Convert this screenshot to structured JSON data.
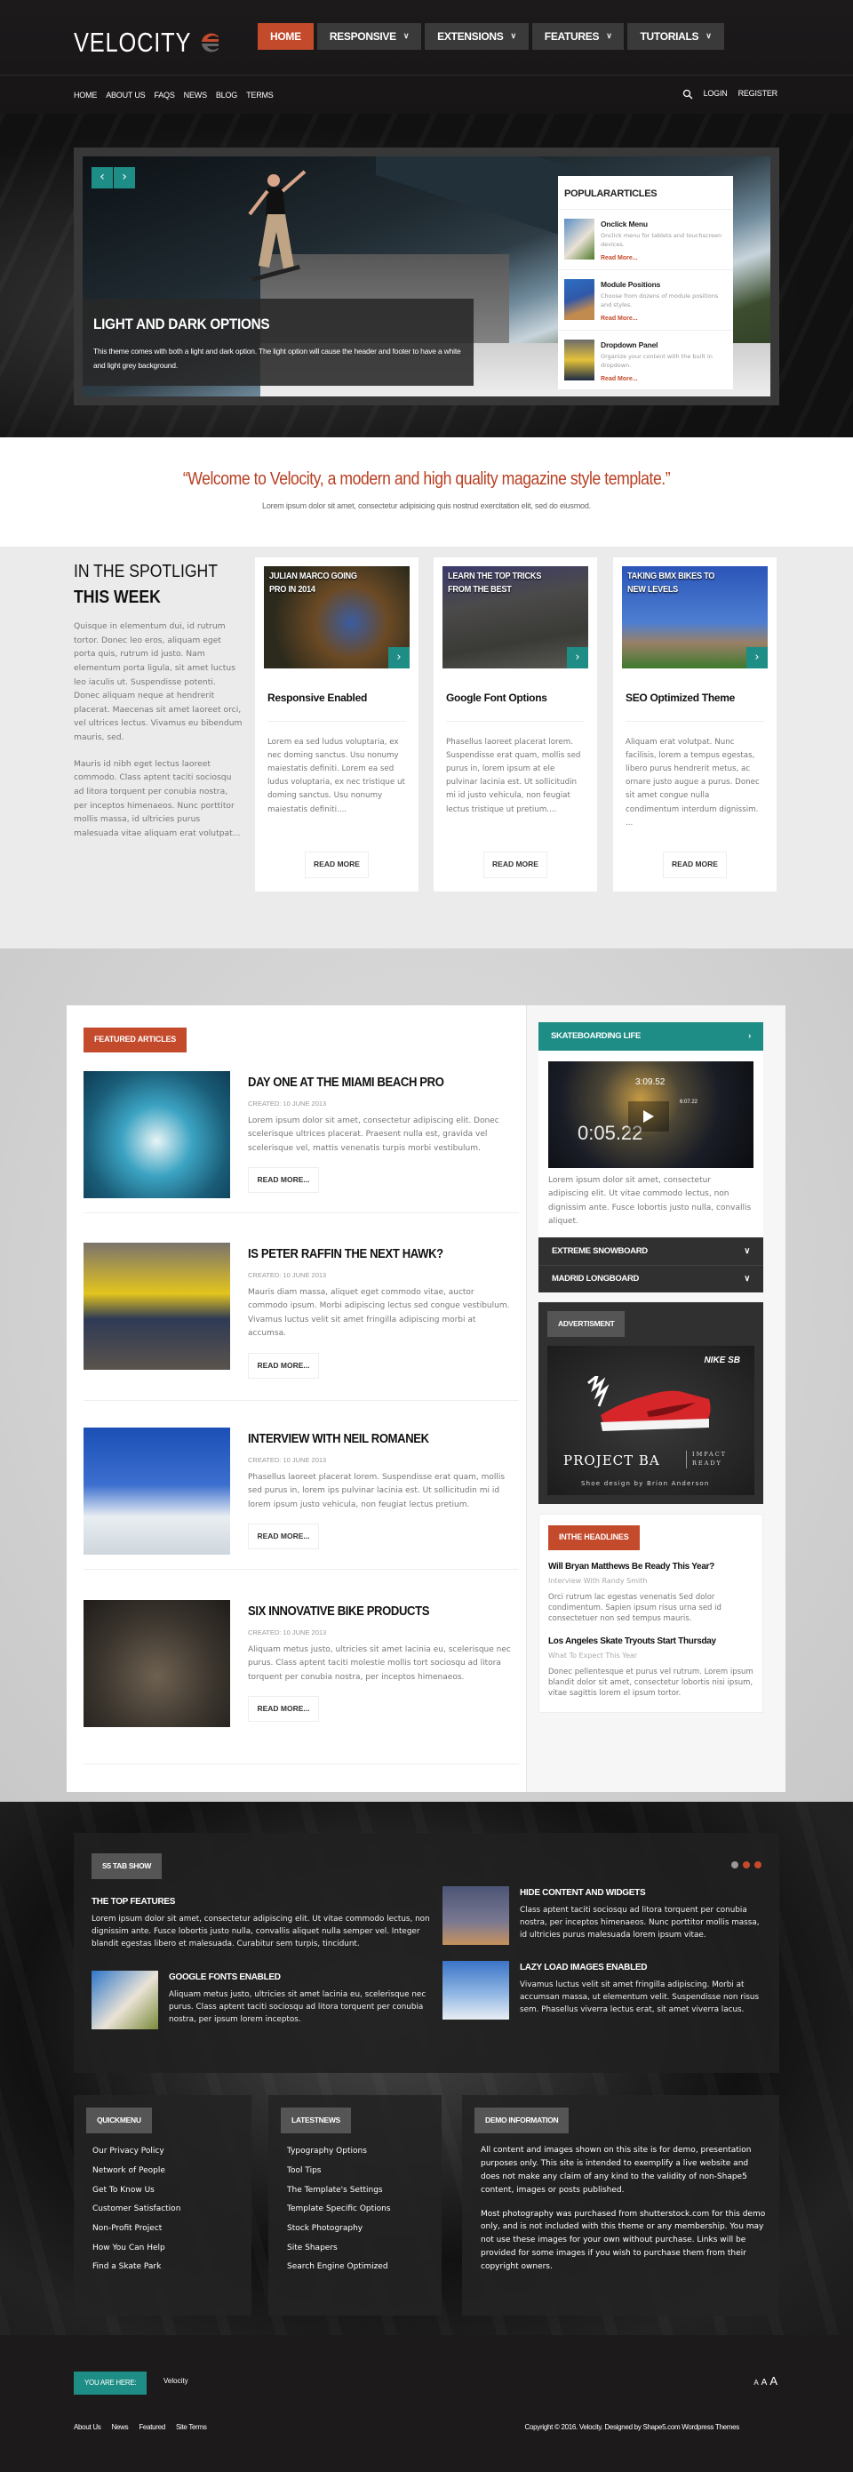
{
  "colors": {
    "accent_red": "#c44a2c",
    "accent_teal": "#1e8d85",
    "dark": "#1c1a1b"
  },
  "header": {
    "logo_text": "VELOCITY",
    "main_nav": [
      {
        "label": "HOME",
        "active": true,
        "dropdown": false
      },
      {
        "label": "RESPONSIVE",
        "active": false,
        "dropdown": true
      },
      {
        "label": "EXTENSIONS",
        "active": false,
        "dropdown": true
      },
      {
        "label": "FEATURES",
        "active": false,
        "dropdown": true
      },
      {
        "label": "TUTORIALS",
        "active": false,
        "dropdown": true
      }
    ],
    "sub_nav": [
      "HOME",
      "ABOUT US",
      "FAQS",
      "NEWS",
      "BLOG",
      "TERMS"
    ],
    "user_links": {
      "search_icon": "search-icon",
      "login": "LOGIN",
      "register": "REGISTER"
    }
  },
  "hero": {
    "prev_icon": "chevron-left-icon",
    "next_icon": "chevron-right-icon",
    "slide_title": "LIGHT AND DARK OPTIONS",
    "slide_text": "This theme comes with both a light and dark option. The light option will cause the header and footer to have a white and light grey background.",
    "popular": {
      "title": "POPULARARTICLES",
      "items": [
        {
          "title": "Onclick Menu",
          "text": "Onclick menu for tablets and touchscreen devices.",
          "link": "Read More..."
        },
        {
          "title": "Module Positions",
          "text": "Choose from dozens of module positions and styles.",
          "link": "Read More..."
        },
        {
          "title": "Dropdown Panel",
          "text": "Organize your content with the built in dropdown.",
          "link": "Read More..."
        }
      ]
    }
  },
  "welcome": {
    "quote": "“Welcome to Velocity, a modern and high quality magazine style template.”",
    "subtext": "Lorem ipsum dolor sit amet, consectetur adipisicing quis nostrud exercitation elit, sed do eiusmod."
  },
  "spotlight": {
    "title_light": "IN THE SPOTLIGHT",
    "title_bold": "THIS WEEK",
    "para1": "Quisque in elementum dui, id rutrum tortor. Donec leo eros, aliquam eget porta quis, rutrum id justo. Nam elementum porta ligula, sit amet luctus leo iaculis ut. Suspendisse potenti. Donec aliquam neque at hendrerit placerat. Maecenas sit amet laoreet orci, vel ultrices lectus. Vivamus eu bibendum mauris, sed.",
    "para2": "Mauris id nibh eget lectus laoreet commodo. Class aptent taciti sociosqu ad litora torquent per conubia nostra, per inceptos himenaeos. Nunc porttitor mollis massa, id ultricies purus malesuada vitae aliquam erat volutpat...",
    "cards": [
      {
        "image_caption": "JULIAN MARCO GOING PRO IN 2014",
        "title": "Responsive Enabled",
        "text": "Lorem ea sed ludus voluptaria, ex nec doming sanctus. Usu nonumy maiestatis definiti. Lorem ea sed ludus voluptaria, ex nec tristique ut doming sanctus. Usu nonumy maiestatis definiti....",
        "button": "READ MORE"
      },
      {
        "image_caption": "LEARN THE TOP TRICKS FROM THE BEST",
        "title": "Google Font Options",
        "text": "Phasellus laoreet placerat lorem. Suspendisse erat quam, mollis sed purus in, lorem ipsum at ele pulvinar lacinia est. Ut sollicitudin mi id justo vehicula, non feugiat lectus tristique ut pretium....",
        "button": "READ MORE"
      },
      {
        "image_caption": "TAKING BMX BIKES TO NEW LEVELS",
        "title": "SEO Optimized Theme",
        "text": "Aliquam erat volutpat. Nunc facilisis, lorem a tempus egestas, libero purus hendrerit metus, ac ornare justo augue a purus. Donec sit amet congue nulla condimentum interdum dignissim. ...",
        "button": "READ MORE"
      }
    ]
  },
  "featured": {
    "label": "FEATURED ARTICLES",
    "articles": [
      {
        "title": "DAY ONE AT THE MIAMI BEACH PRO",
        "date": "CREATED: 10 JUNE 2013",
        "text": "Lorem ipsum dolor sit amet, consectetur adipiscing elit. Donec scelerisque ultrices placerat. Praesent nulla est, gravida vel scelerisque vel, mattis venenatis turpis morbi vestibulum.",
        "button": "READ MORE..."
      },
      {
        "title": "IS PETER RAFFIN THE NEXT HAWK?",
        "date": "CREATED: 10 JUNE 2013",
        "text": "Mauris diam massa, aliquet eget commodo vitae, auctor commodo ipsum. Morbi adipiscing lectus sed congue vestibulum. Vivamus luctus velit sit amet fringilla adipiscing morbi at accumsa.",
        "button": "READ MORE..."
      },
      {
        "title": "INTERVIEW WITH NEIL ROMANEK",
        "date": "CREATED: 10 JUNE 2013",
        "text": "Phasellus laoreet placerat lorem. Suspendisse erat quam, mollis sed purus in, lorem ips pulvinar lacinia est. Ut sollicitudin mi id lorem ipsum justo vehicula, non feugiat lectus pretium.",
        "button": "READ MORE..."
      },
      {
        "title": "SIX INNOVATIVE BIKE PRODUCTS",
        "date": "CREATED: 10 JUNE 2013",
        "text": "Aliquam metus justo, ultricies sit amet lacinia eu, scelerisque nec purus. Class aptent taciti molestie mollis tort sociosqu ad litora torquent per conubia nostra, per inceptos himenaeos.",
        "button": "READ MORE..."
      }
    ]
  },
  "sidebar": {
    "skate": {
      "title": "SKATEBOARDING LIFE",
      "video_time_main": "0:05.22",
      "video_time_top": "3:09.52",
      "video_time_small": "6:07.22",
      "text": "Lorem ipsum dolor sit amet, consectetur adipiscing elit. Ut vitae commodo lectus, non dignissim ante. Fusce lobortis justo nulla, convallis aliquet."
    },
    "accordions": [
      "EXTREME SNOWBOARD",
      "MADRID LONGBOARD"
    ],
    "ad": {
      "label": "ADVERTISMENT",
      "brand": "NIKE SB",
      "product": "PROJECT BA",
      "tagline1": "IMPACT",
      "tagline2": "READY",
      "credit": "Shoe design by Brion Anderson"
    },
    "headlines": {
      "label": "INTHE HEADLINES",
      "items": [
        {
          "title": "Will Bryan Matthews Be Ready This Year?",
          "subtitle": "Interview With Randy Smith",
          "text": "Orci rutrum lac egestas venenatis Sed dolor condimentum. Sapien ipsum risus urna sed id consectetuer non sed tempus mauris."
        },
        {
          "title": "Los Angeles Skate Tryouts Start Thursday",
          "subtitle": "What To Expect This Year",
          "text": "Donec pellentesque et purus vel rutrum. Lorem ipsum blandit dolor sit amet, consectetur lobortis nisi ipsum, vitae sagittis lorem el ipsum tortor."
        }
      ]
    }
  },
  "tabshow": {
    "label": "S5 TAB SHOW",
    "active_dot": 0,
    "dot_count": 3,
    "top_feature": {
      "title": "THE TOP FEATURES",
      "text": "Lorem ipsum dolor sit amet, consectetur adipiscing elit. Ut vitae commodo lectus, non dignissim ante. Fusce lobortis justo nulla, convallis aliquet nulla semper vel. Integer blandit egestas libero et malesuada. Curabitur sem turpis, tincidunt."
    },
    "items": [
      {
        "title": "GOOGLE FONTS ENABLED",
        "text": "Aliquam metus justo, ultricies sit amet lacinia eu, scelerisque nec purus. Class aptent taciti sociosqu ad litora torquent per conubia nostra, per ipsum lorem inceptos."
      },
      {
        "title": "HIDE CONTENT AND WIDGETS",
        "text": "Class aptent taciti sociosqu ad litora torquent per conubia nostra, per inceptos himenaeos. Nunc porttitor mollis massa, id ultricies purus malesuada lorem ipsum vitae."
      },
      {
        "title": "LAZY LOAD IMAGES ENABLED",
        "text": "Vivamus luctus velit sit amet fringilla adipiscing. Morbi at accumsan massa, ut elementum velit. Suspendisse non risus sem. Phasellus viverra lectus erat, sit amet viverra lacus."
      }
    ]
  },
  "footer_columns": {
    "quickmenu": {
      "label": "QUICKMENU",
      "links": [
        "Our Privacy Policy",
        "Network of People",
        "Get To Know Us",
        "Customer Satisfaction",
        "Non-Profit Project",
        "How You Can Help",
        "Find a Skate Park"
      ]
    },
    "latestnews": {
      "label": "LATESTNEWS",
      "links": [
        "Typography Options",
        "Tool Tips",
        "The Template's Settings",
        "Template Specific Options",
        "Stock Photography",
        "Site Shapers",
        "Search Engine Optimized"
      ]
    },
    "demo": {
      "label": "DEMO INFORMATION",
      "para1": "All content and images shown on this site is for demo, presentation purposes only. This site is intended to exemplify a live website and does not make any claim of any kind to the validity of non-Shape5 content, images or posts published.",
      "para2": "Most photography was purchased from shutterstock.com for this demo only, and is not included with this theme or any membership. You may not use these images for your own without purchase. Links will be provided for some images if you wish to purchase them from their copyright owners."
    }
  },
  "footer": {
    "you_are_here": "YOU ARE HERE:",
    "breadcrumb": "Velocity",
    "font_sizes": [
      "A",
      "A",
      "A"
    ],
    "links": [
      "About Us",
      "News",
      "Featured",
      "Site Terms"
    ],
    "copyright": "Copyright © 2016. Velocity. Designed by Shape5.com Wordpress Themes"
  }
}
